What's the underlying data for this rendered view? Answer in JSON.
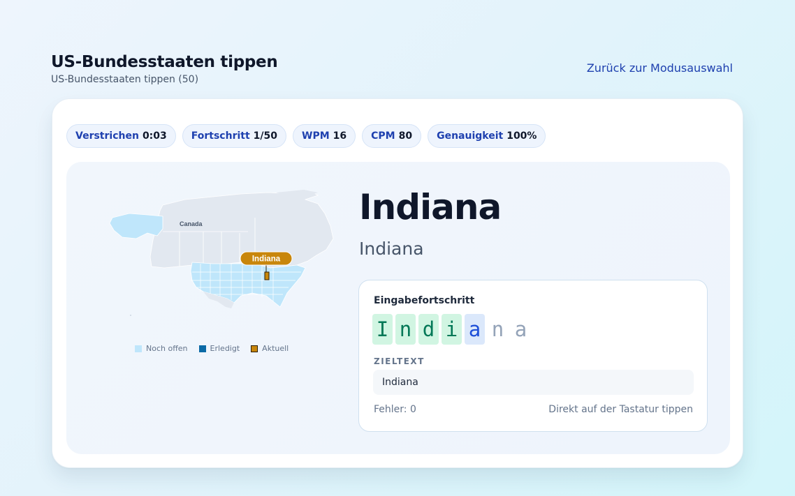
{
  "header": {
    "title": "US-Bundesstaaten tippen",
    "subtitle": "US-Bundesstaaten tippen (50)",
    "back_link": "Zurück zur Modusauswahl"
  },
  "stats": [
    {
      "label": "Verstrichen",
      "value": "0:03"
    },
    {
      "label": "Fortschritt",
      "value": "1/50"
    },
    {
      "label": "WPM",
      "value": "16"
    },
    {
      "label": "CPM",
      "value": "80"
    },
    {
      "label": "Genauigkeit",
      "value": "100%"
    }
  ],
  "map": {
    "country_label": "Canada",
    "current_state_label": "Indiana",
    "colors": {
      "open": "#bfe6fb",
      "done": "#0b6aa6",
      "current": "#c8860b",
      "land": "#e2e8f0"
    }
  },
  "legend": [
    {
      "label": "Noch offen",
      "color": "#bfe6fb"
    },
    {
      "label": "Erledigt",
      "color": "#0b6aa6"
    },
    {
      "label": "Aktuell",
      "color": "#c8860b"
    }
  ],
  "prompt": {
    "title": "Indiana",
    "subtitle": "Indiana"
  },
  "typing": {
    "progress_label": "Eingabefortschritt",
    "chars": [
      {
        "char": "I",
        "state": "correct"
      },
      {
        "char": "n",
        "state": "correct"
      },
      {
        "char": "d",
        "state": "correct"
      },
      {
        "char": "i",
        "state": "correct"
      },
      {
        "char": "a",
        "state": "current"
      },
      {
        "char": "n",
        "state": "pending"
      },
      {
        "char": "a",
        "state": "pending"
      }
    ],
    "target_label": "ZIELTEXT",
    "target_text": "Indiana",
    "errors": "Fehler: 0",
    "hint": "Direkt auf der Tastatur tippen"
  }
}
